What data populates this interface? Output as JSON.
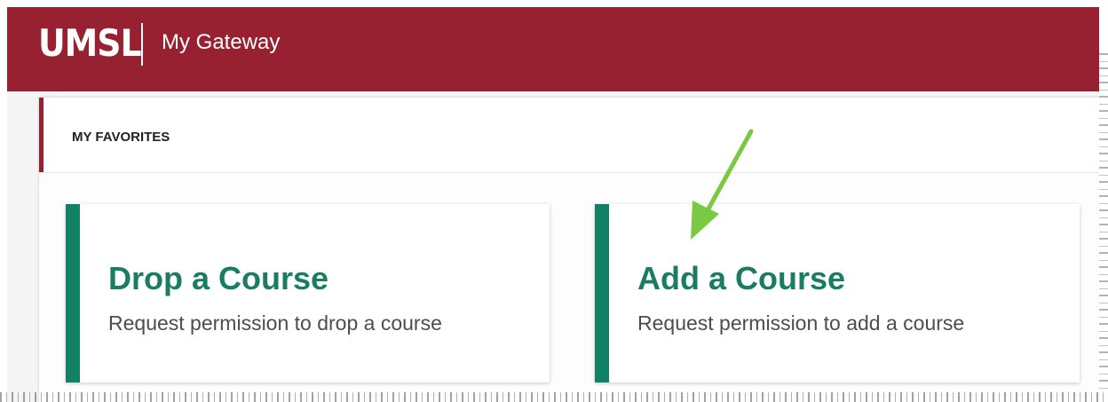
{
  "header": {
    "logo_text": "UMSL",
    "app_title": "My Gateway",
    "brand_color": "#972031"
  },
  "favorites": {
    "title": "MY FAVORITES",
    "cards": [
      {
        "title": "Drop a Course",
        "description": "Request permission to drop a course",
        "accent_color": "#128064"
      },
      {
        "title": "Add a Course",
        "description": "Request permission to add a course",
        "accent_color": "#128064"
      }
    ]
  },
  "annotation": {
    "icon": "arrow-down-left-icon",
    "color": "#7ac943"
  }
}
